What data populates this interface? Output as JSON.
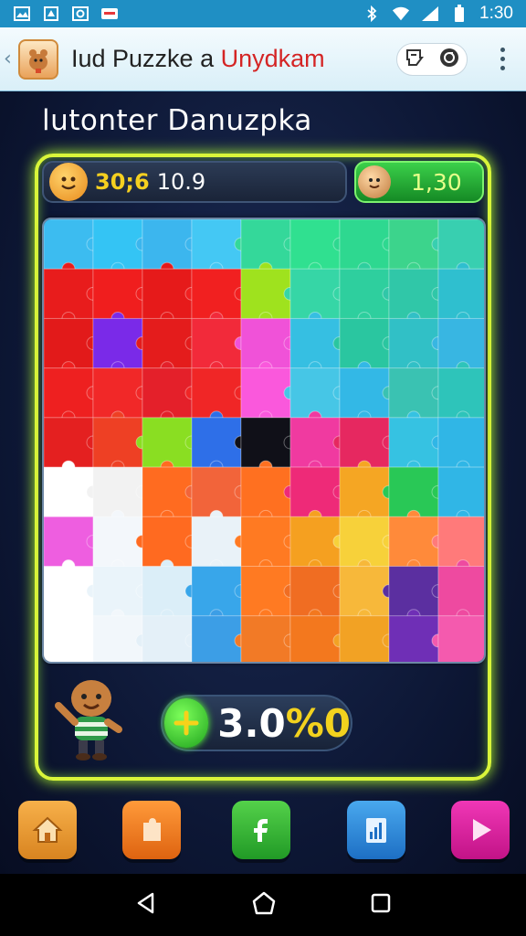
{
  "status_bar": {
    "time": "1:30",
    "icons": [
      "gallery-icon",
      "shield-icon",
      "sync-icon",
      "message-icon",
      "bluetooth-icon",
      "wifi-icon",
      "signal-icon",
      "battery-icon"
    ]
  },
  "app_bar": {
    "title_main": "Iud Puzzke a",
    "title_accent": "Unydkam",
    "icons": [
      "app-logo-icon",
      "share-icon",
      "refresh-icon",
      "overflow-menu-icon"
    ]
  },
  "section": {
    "title": "lutonter Danuzpka"
  },
  "score": {
    "label": "30;6",
    "value": "10.9"
  },
  "coins": {
    "value": "1,30"
  },
  "progress": {
    "value": "3.0",
    "suffix": "%0"
  },
  "bottom_nav": {
    "buttons": [
      {
        "name": "home",
        "icon": "home-icon",
        "color": "#f0a138"
      },
      {
        "name": "pieces",
        "icon": "piece-icon",
        "color": "#f07a20"
      },
      {
        "name": "share",
        "icon": "facebook-icon",
        "color": "#3cb83a"
      },
      {
        "name": "stats",
        "icon": "chart-icon",
        "color": "#2f8ee0"
      },
      {
        "name": "play",
        "icon": "play-icon",
        "color": "#e21f9a"
      }
    ]
  },
  "puzzle": {
    "rows": 9,
    "cols": 9,
    "colors": [
      [
        "#3cbcf0",
        "#34c4f4",
        "#3cb6ee",
        "#44c8f4",
        "#34d89a",
        "#30e090",
        "#2ed890",
        "#3cd48c",
        "#38cfb0"
      ],
      [
        "#e81c1c",
        "#f01e1e",
        "#e61a1a",
        "#f12020",
        "#9fe21e",
        "#36d6a6",
        "#2ecf9e",
        "#30c7a8",
        "#2fbfcf"
      ],
      [
        "#e21a1a",
        "#7a2ae8",
        "#e41c1c",
        "#f22a3a",
        "#f052d8",
        "#36bfe2",
        "#2ac6a0",
        "#31c0c6",
        "#38b6e2"
      ],
      [
        "#ee2020",
        "#f12828",
        "#e4202a",
        "#f02626",
        "#fa58dc",
        "#46c6e6",
        "#33b8e6",
        "#3ac2b2",
        "#2ec4ba"
      ],
      [
        "#e42020",
        "#ee4024",
        "#8ade22",
        "#2e6fe8",
        "#101018",
        "#f03aa0",
        "#e62860",
        "#36c2e2",
        "#30b6e6"
      ],
      [
        "#ffffff",
        "#f2f2f2",
        "#ff6b20",
        "#f2643a",
        "#ff7020",
        "#ee2a78",
        "#f5a623",
        "#29c856",
        "#30b6e6"
      ],
      [
        "#ee5ee0",
        "#f3f7fb",
        "#ff6a20",
        "#e9f2f8",
        "#ff7a22",
        "#f5a020",
        "#f7d13a",
        "#ff8a3a",
        "#ff7a7a"
      ],
      [
        "#ffffff",
        "#eaf4fa",
        "#dbeef8",
        "#38a6ea",
        "#ff7a22",
        "#f06d22",
        "#f7b83a",
        "#5b2fa0",
        "#ee4aa0"
      ],
      [
        "#ffffff",
        "#f2f7fb",
        "#e4f0f8",
        "#3c9ee6",
        "#f27a26",
        "#f3781e",
        "#f2a224",
        "#6f2fb6",
        "#f45aae"
      ]
    ]
  }
}
